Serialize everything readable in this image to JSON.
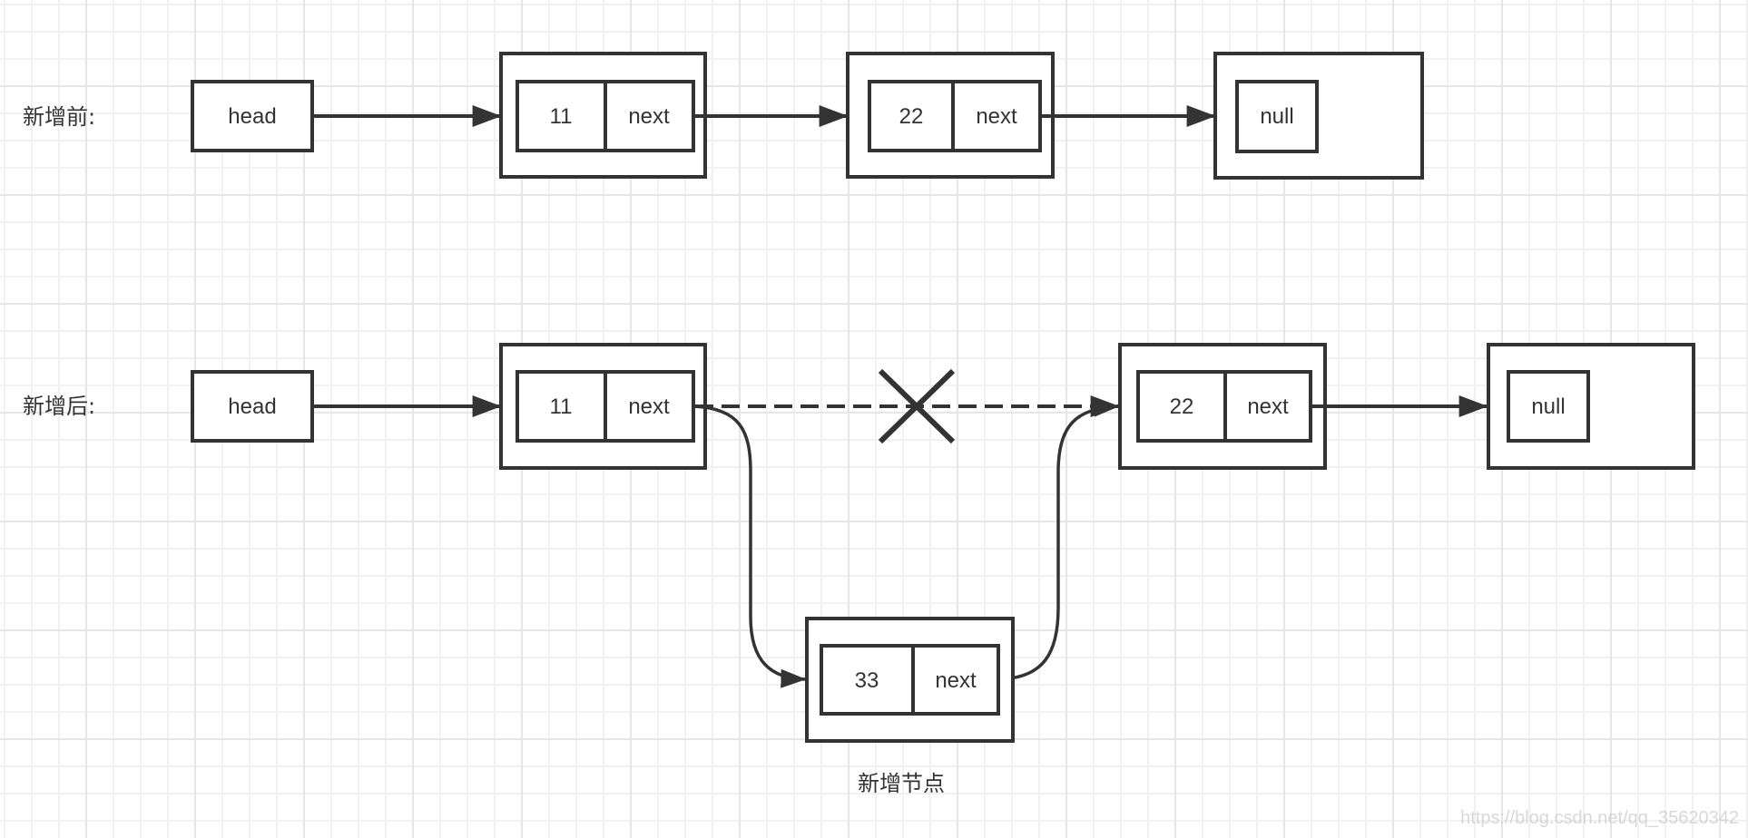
{
  "diagram": {
    "sections": [
      {
        "label": "新增前:",
        "head_label": "head",
        "nodes": [
          {
            "value": "11",
            "pointer": "next"
          },
          {
            "value": "22",
            "pointer": "next"
          },
          {
            "value": "null"
          }
        ]
      },
      {
        "label": "新增后:",
        "head_label": "head",
        "nodes": [
          {
            "value": "11",
            "pointer": "next"
          },
          {
            "value": "22",
            "pointer": "next"
          },
          {
            "value": "null"
          }
        ],
        "removed_link": {
          "from": "11",
          "to": "22",
          "style": "dashed",
          "marker": "cross"
        },
        "inserted_node": {
          "value": "33",
          "pointer": "next",
          "caption": "新增节点"
        },
        "new_links": [
          {
            "from": "11",
            "to": "33"
          },
          {
            "from": "33",
            "to": "22"
          }
        ]
      }
    ],
    "colors": {
      "stroke": "#333333",
      "grid_minor": "#f1f1f1",
      "grid_major": "#e6e6e6",
      "background": "#ffffff"
    }
  },
  "watermark": "https://blog.csdn.net/qq_35620342"
}
